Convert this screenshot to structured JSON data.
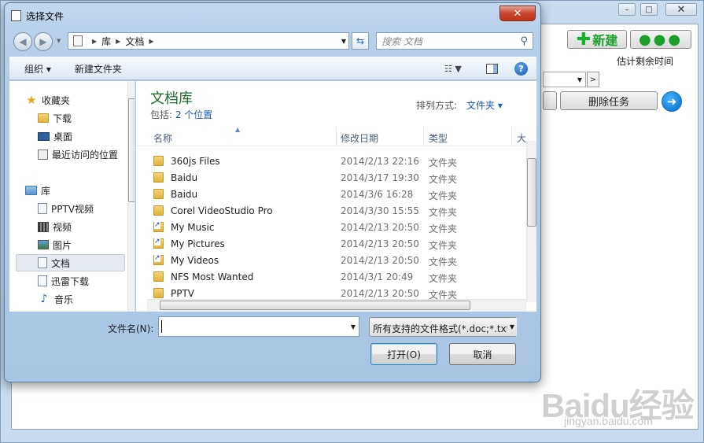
{
  "background_app": {
    "new_button_label": "新建",
    "more_button_label": "●●●",
    "column_remaining_time": "估计剩余时间",
    "delete_task_button": "删除任务"
  },
  "watermark": {
    "logo": "Baidu经验",
    "url": "jingyan.baidu.com"
  },
  "dialog": {
    "title": "选择文件",
    "address": {
      "segments": [
        "库",
        "文档"
      ]
    },
    "search_placeholder": "搜索 文档",
    "toolbar": {
      "organize": "组织 ▾",
      "new_folder": "新建文件夹"
    },
    "nav": {
      "favorites": [
        {
          "label": "收藏夹",
          "icon": "star-icon"
        },
        {
          "label": "下载",
          "icon": "download-folder-icon"
        },
        {
          "label": "桌面",
          "icon": "desktop-icon"
        },
        {
          "label": "最近访问的位置",
          "icon": "recent-places-icon"
        }
      ],
      "libraries": [
        {
          "label": "库",
          "icon": "library-icon"
        },
        {
          "label": "PPTV视频",
          "icon": "document-icon"
        },
        {
          "label": "视频",
          "icon": "video-icon"
        },
        {
          "label": "图片",
          "icon": "pictures-icon"
        },
        {
          "label": "文档",
          "icon": "document-icon",
          "selected": true
        },
        {
          "label": "迅雷下载",
          "icon": "document-icon"
        },
        {
          "label": "音乐",
          "icon": "music-icon"
        }
      ]
    },
    "library": {
      "title": "文档库",
      "includes_prefix": "包括: ",
      "includes_link": "2 个位置",
      "arrange_label": "排列方式:",
      "arrange_value": "文件夹 ▾"
    },
    "columns": {
      "name": "名称",
      "modified": "修改日期",
      "type": "类型",
      "size": "大"
    },
    "files": [
      {
        "name": "360js Files",
        "modified": "2014/2/13 22:16",
        "type": "文件夹",
        "icon": "folder-icon"
      },
      {
        "name": "Baidu",
        "modified": "2014/3/17 19:30",
        "type": "文件夹",
        "icon": "folder-icon"
      },
      {
        "name": "Baidu",
        "modified": "2014/3/6 16:28",
        "type": "文件夹",
        "icon": "folder-icon"
      },
      {
        "name": "Corel VideoStudio Pro",
        "modified": "2014/3/30 15:55",
        "type": "文件夹",
        "icon": "folder-icon"
      },
      {
        "name": "My Music",
        "modified": "2014/2/13 20:50",
        "type": "文件夹",
        "icon": "shortcut-folder-icon"
      },
      {
        "name": "My Pictures",
        "modified": "2014/2/13 20:50",
        "type": "文件夹",
        "icon": "shortcut-folder-icon"
      },
      {
        "name": "My Videos",
        "modified": "2014/2/13 20:50",
        "type": "文件夹",
        "icon": "shortcut-folder-icon"
      },
      {
        "name": "NFS Most Wanted",
        "modified": "2014/3/1 20:49",
        "type": "文件夹",
        "icon": "folder-icon"
      },
      {
        "name": "PPTV",
        "modified": "2014/2/13 20:50",
        "type": "文件夹",
        "icon": "folder-icon"
      }
    ],
    "filename_label": "文件名(N):",
    "filename_value": "",
    "filter_value": "所有支持的文件格式(*.doc;*.txt",
    "open_button": "打开(O)",
    "cancel_button": "取消"
  }
}
